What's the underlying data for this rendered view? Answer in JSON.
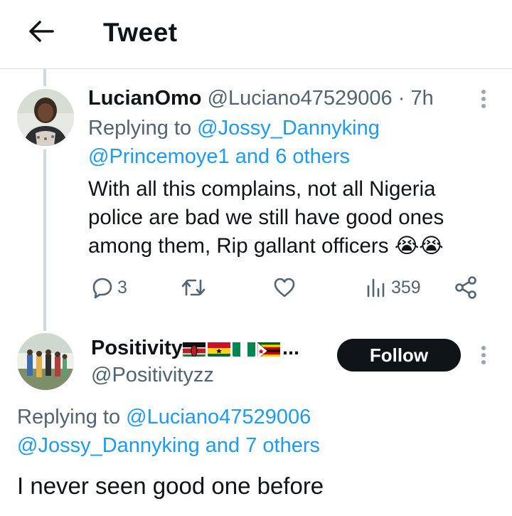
{
  "header": {
    "title": "Tweet",
    "back_icon": "arrow-left-icon"
  },
  "tweets": [
    {
      "display_name": "LucianOmo",
      "handle": "@Luciano47529006",
      "separator": "·",
      "time": "7h",
      "reply_prefix": "Replying to",
      "reply_mention_1": "@Jossy_Dannyking",
      "reply_mention_2": "@Princemoye1",
      "reply_and": "and 6 others",
      "text_line1": "With all this complains, not all Nigeria",
      "text_line2": "police are bad we still have good ones",
      "text_line3": "among them, Rip gallant officers 😭😭",
      "replies": "3",
      "retweets": "",
      "likes": "",
      "views": "359"
    },
    {
      "display_name": "Positivity",
      "flags": [
        "kenya",
        "ghana",
        "nigeria",
        "zimbabwe"
      ],
      "name_ellipsis": "...",
      "handle": "@Positivityzz",
      "follow_label": "Follow",
      "reply_prefix": "Replying to",
      "reply_mention_1": "@Luciano47529006",
      "reply_mention_2": "@Jossy_Dannyking",
      "reply_and": "and 7 others",
      "text": "I never seen good one before"
    }
  ],
  "colors": {
    "link": "#1d9bf0",
    "muted": "#536471",
    "text": "#0f1419",
    "follow_bg": "#0f1419"
  }
}
